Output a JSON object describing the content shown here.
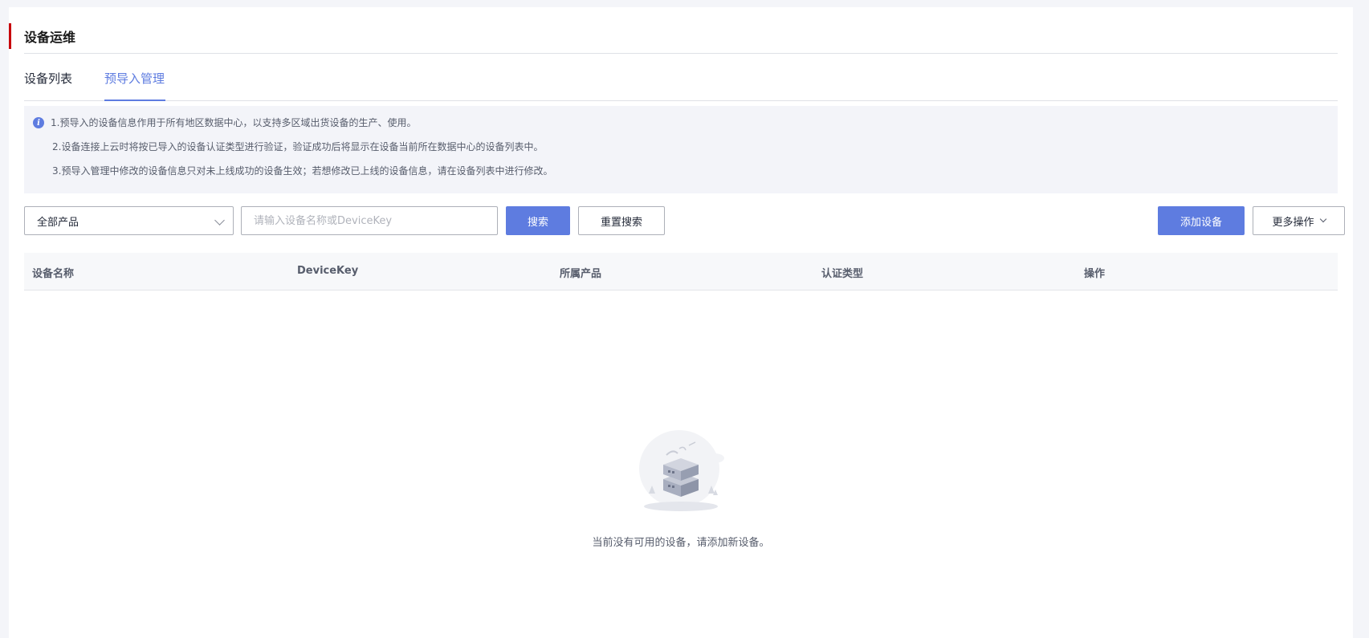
{
  "header": {
    "title": "设备运维"
  },
  "tabs": [
    {
      "label": "设备列表",
      "active": false
    },
    {
      "label": "预导入管理",
      "active": true
    }
  ],
  "notice": {
    "lines": [
      "1.预导入的设备信息作用于所有地区数据中心，以支持多区域出货设备的生产、使用。",
      "2.设备连接上云时将按已导入的设备认证类型进行验证，验证成功后将显示在设备当前所在数据中心的设备列表中。",
      "3.预导入管理中修改的设备信息只对未上线成功的设备生效；若想修改已上线的设备信息，请在设备列表中进行修改。"
    ]
  },
  "toolbar": {
    "product_select": "全部产品",
    "search_placeholder": "请输入设备名称或DeviceKey",
    "search_label": "搜索",
    "reset_label": "重置搜索",
    "add_label": "添加设备",
    "more_label": "更多操作"
  },
  "table": {
    "columns": [
      "设备名称",
      "DeviceKey",
      "所属产品",
      "认证类型",
      "操作"
    ],
    "rows": []
  },
  "empty": {
    "message": "当前没有可用的设备，请添加新设备。"
  },
  "colors": {
    "primary": "#5e7ce0",
    "accent_bar": "#c7000b"
  }
}
